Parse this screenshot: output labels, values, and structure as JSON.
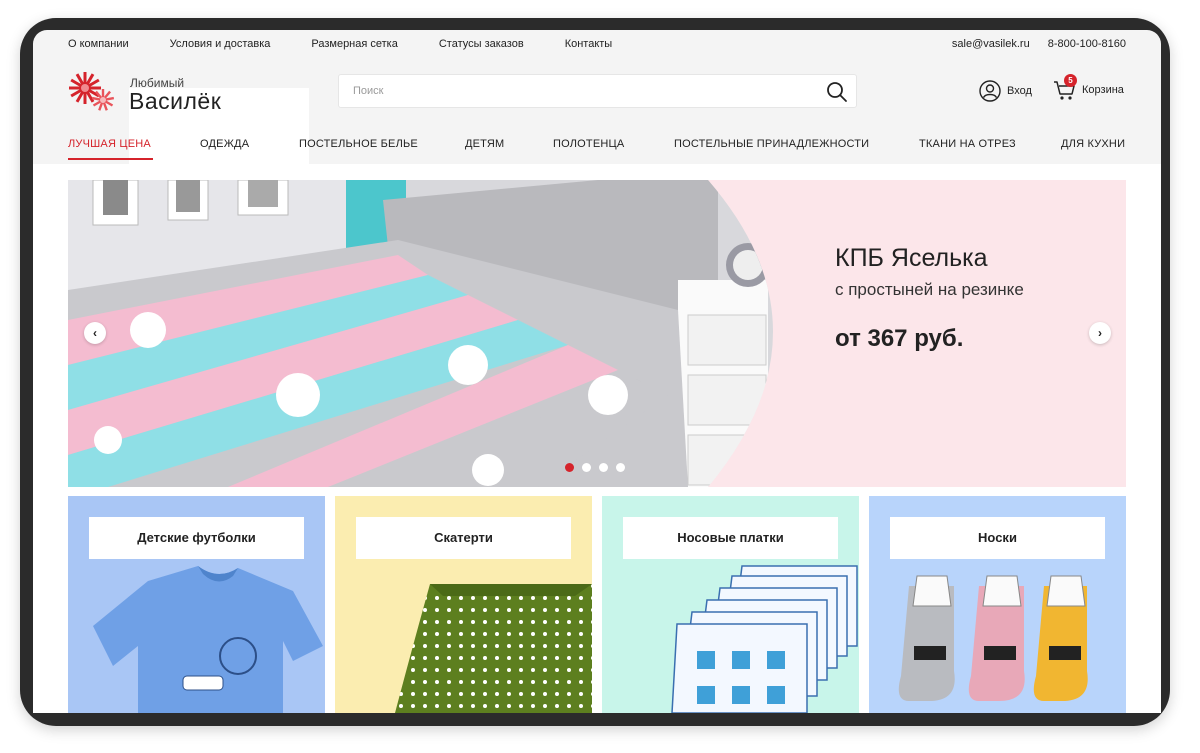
{
  "topbar": {
    "links": [
      "О компании",
      "Условия и доставка",
      "Размерная сетка",
      "Статусы заказов",
      "Контакты"
    ],
    "email": "sale@vasilek.ru",
    "phone": "8-800-100-8160"
  },
  "logo": {
    "sub": "Любимый",
    "main": "Василёк"
  },
  "search": {
    "placeholder": "Поиск"
  },
  "account": {
    "login_label": "Вход",
    "cart_label": "Корзина",
    "cart_count": "5"
  },
  "nav": {
    "items": [
      "ЛУЧШАЯ ЦЕНА",
      "ОДЕЖДА",
      "ПОСТЕЛЬНОЕ БЕЛЬЕ",
      "ДЕТЯМ",
      "ПОЛОТЕНЦА",
      "ПОСТЕЛЬНЫЕ ПРИНАДЛЕЖНОСТИ",
      "ТКАНИ НА ОТРЕЗ",
      "ДЛЯ КУХНИ"
    ],
    "active_index": 0
  },
  "banner": {
    "title": "КПБ Яселька",
    "subtitle": "с простыней на резинке",
    "price": "от 367 руб.",
    "slide_count": 4,
    "active_slide": 0
  },
  "categories": [
    {
      "label": "Детские футболки",
      "bg": "#a9c6f5"
    },
    {
      "label": "Скатерти",
      "bg": "#fbedb0"
    },
    {
      "label": "Носовые платки",
      "bg": "#c8f5ea"
    },
    {
      "label": "Носки",
      "bg": "#b8d4fb"
    }
  ],
  "colors": {
    "accent": "#d5232b",
    "banner_bg": "#fce6ea",
    "page_bg": "#f4f4f4"
  },
  "icons": [
    "logo-flower-icon",
    "search-icon",
    "user-icon",
    "cart-icon",
    "chevron-left-icon",
    "chevron-right-icon"
  ]
}
